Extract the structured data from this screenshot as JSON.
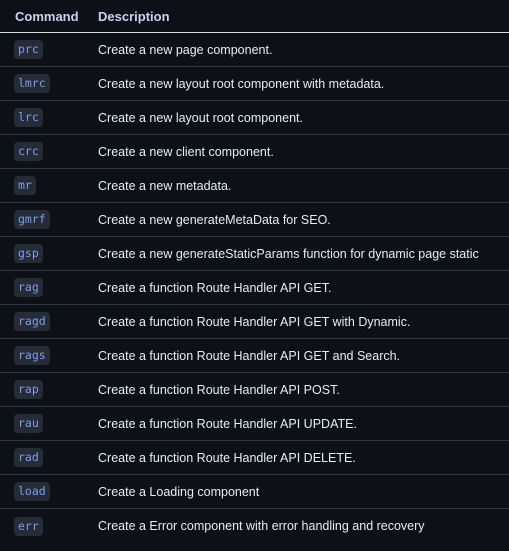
{
  "table": {
    "headers": {
      "command": "Command",
      "description": "Description"
    },
    "rows": [
      {
        "command": "prc",
        "description": "Create a new page component."
      },
      {
        "command": "lmrc",
        "description": "Create a new layout root component with metadata."
      },
      {
        "command": "lrc",
        "description": "Create a new layout root component."
      },
      {
        "command": "crc",
        "description": "Create a new client component."
      },
      {
        "command": "mr",
        "description": "Create a new metadata."
      },
      {
        "command": "gmrf",
        "description": "Create a new generateMetaData for SEO."
      },
      {
        "command": "gsp",
        "description": "Create a new generateStaticParams function for dynamic page static"
      },
      {
        "command": "rag",
        "description": "Create a function Route Handler API GET."
      },
      {
        "command": "ragd",
        "description": "Create a function Route Handler API GET with Dynamic."
      },
      {
        "command": "rags",
        "description": "Create a function Route Handler API GET and Search."
      },
      {
        "command": "rap",
        "description": "Create a function Route Handler API POST."
      },
      {
        "command": "rau",
        "description": "Create a function Route Handler API UPDATE."
      },
      {
        "command": "rad",
        "description": "Create a function Route Handler API DELETE."
      },
      {
        "command": "load",
        "description": "Create a Loading component"
      },
      {
        "command": "err",
        "description": "Create a Error component with error handling and recovery"
      }
    ]
  },
  "colors": {
    "background": "#0d1117",
    "header_text": "#c9d1f5",
    "code_text": "#7c9cf0",
    "code_background": "#262c36",
    "row_border": "#30363d"
  }
}
